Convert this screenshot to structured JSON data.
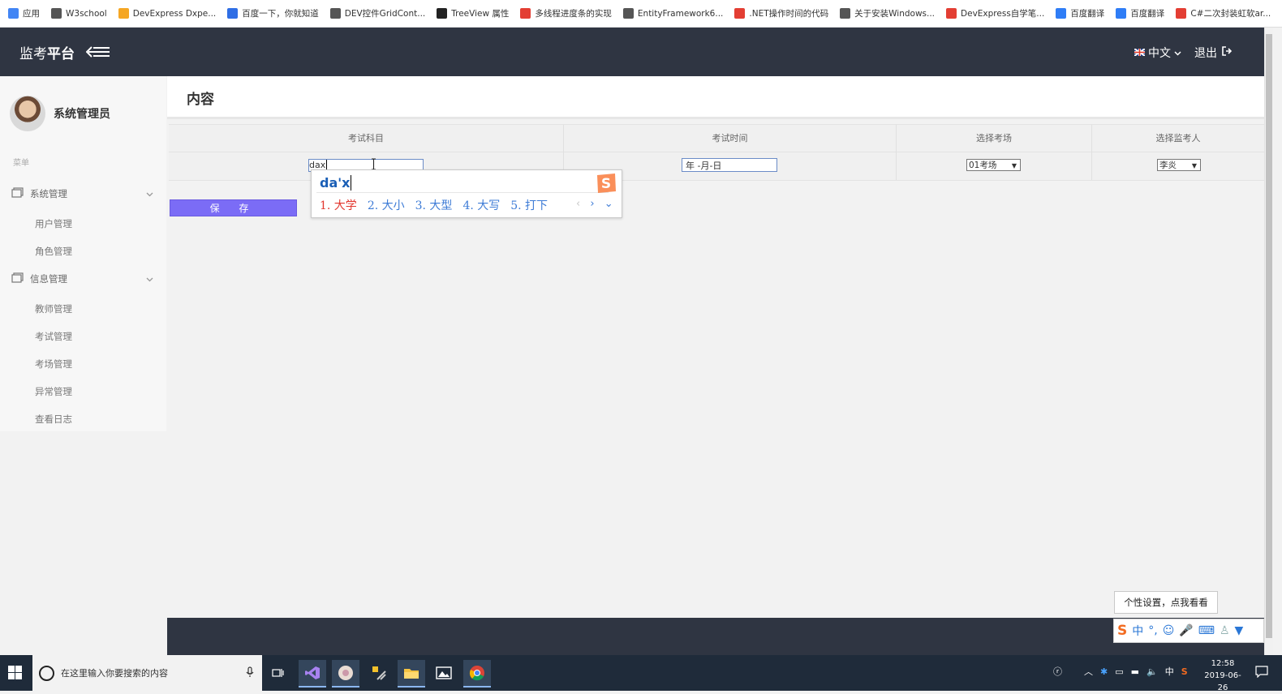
{
  "bookmarks": [
    {
      "label": "应用",
      "icon": "apps-grid-icon",
      "color": "#4285f4"
    },
    {
      "label": "W3school",
      "icon": "globe-icon",
      "color": "#555555"
    },
    {
      "label": "DevExpress Dxpe...",
      "icon": "devexpress-icon",
      "color": "#f5a623"
    },
    {
      "label": "百度一下，你就知道",
      "icon": "baidu-paw-icon",
      "color": "#2f6ee5"
    },
    {
      "label": "DEV控件GridCont...",
      "icon": "vs-icon",
      "color": "#555555"
    },
    {
      "label": "TreeView 属性",
      "icon": "msdn-m-icon",
      "color": "#222222"
    },
    {
      "label": "多线程进度条的实现",
      "icon": "csdn-c-icon",
      "color": "#e33e33"
    },
    {
      "label": "EntityFramework6...",
      "icon": "vs-icon",
      "color": "#555555"
    },
    {
      "label": ".NET操作时间的代码",
      "icon": "csdn-c-icon",
      "color": "#e33e33"
    },
    {
      "label": "关于安装Windows...",
      "icon": "globe-icon",
      "color": "#555555"
    },
    {
      "label": "DevExpress自学笔...",
      "icon": "csdn-c-icon",
      "color": "#e33e33"
    },
    {
      "label": "百度翻译",
      "icon": "baidu-translate-icon",
      "color": "#2f7df6"
    },
    {
      "label": "百度翻译",
      "icon": "baidu-translate-icon",
      "color": "#2f7df6"
    },
    {
      "label": "C#二次封装虹软ar...",
      "icon": "csdn-c-icon",
      "color": "#e33e33"
    }
  ],
  "header": {
    "brand_prefix": "监考",
    "brand_bold": "平台",
    "language": "中文",
    "logout": "退出"
  },
  "sidebar": {
    "user_name": "系统管理员",
    "menu_caption": "菜单",
    "groups": [
      {
        "label": "系统管理",
        "items": [
          "用户管理",
          "角色管理"
        ]
      },
      {
        "label": "信息管理",
        "items": [
          "教师管理",
          "考试管理",
          "考场管理",
          "异常管理",
          "查看日志"
        ]
      }
    ]
  },
  "content": {
    "title": "内容",
    "columns": [
      "考试科目",
      "考试时间",
      "选择考场",
      "选择监考人"
    ],
    "subject_value": "dax",
    "date_placeholder": "年 -月-日",
    "room_selected": "01考场",
    "proctor_selected": "李炎",
    "save_label": "保  存"
  },
  "ime": {
    "composition": "da'x",
    "candidates": [
      "1. 大学",
      "2. 大小",
      "3. 大型",
      "4. 大写",
      "5. 打下"
    ],
    "logo": "S"
  },
  "tooltip": "个性设置，点我看看",
  "ime_toolbar": [
    "中",
    "°,",
    "☺",
    "🎤",
    "⌨"
  ],
  "taskbar": {
    "search_placeholder": "在这里输入你要搜索的内容",
    "time": "12:58",
    "date": "2019-06-26",
    "tray_ime": "中"
  },
  "colors": {
    "topbar": "#2f3542",
    "save_button": "#7b6cf6",
    "ime_first_candidate": "#e2372e",
    "ime_candidate": "#3d7bd6"
  }
}
